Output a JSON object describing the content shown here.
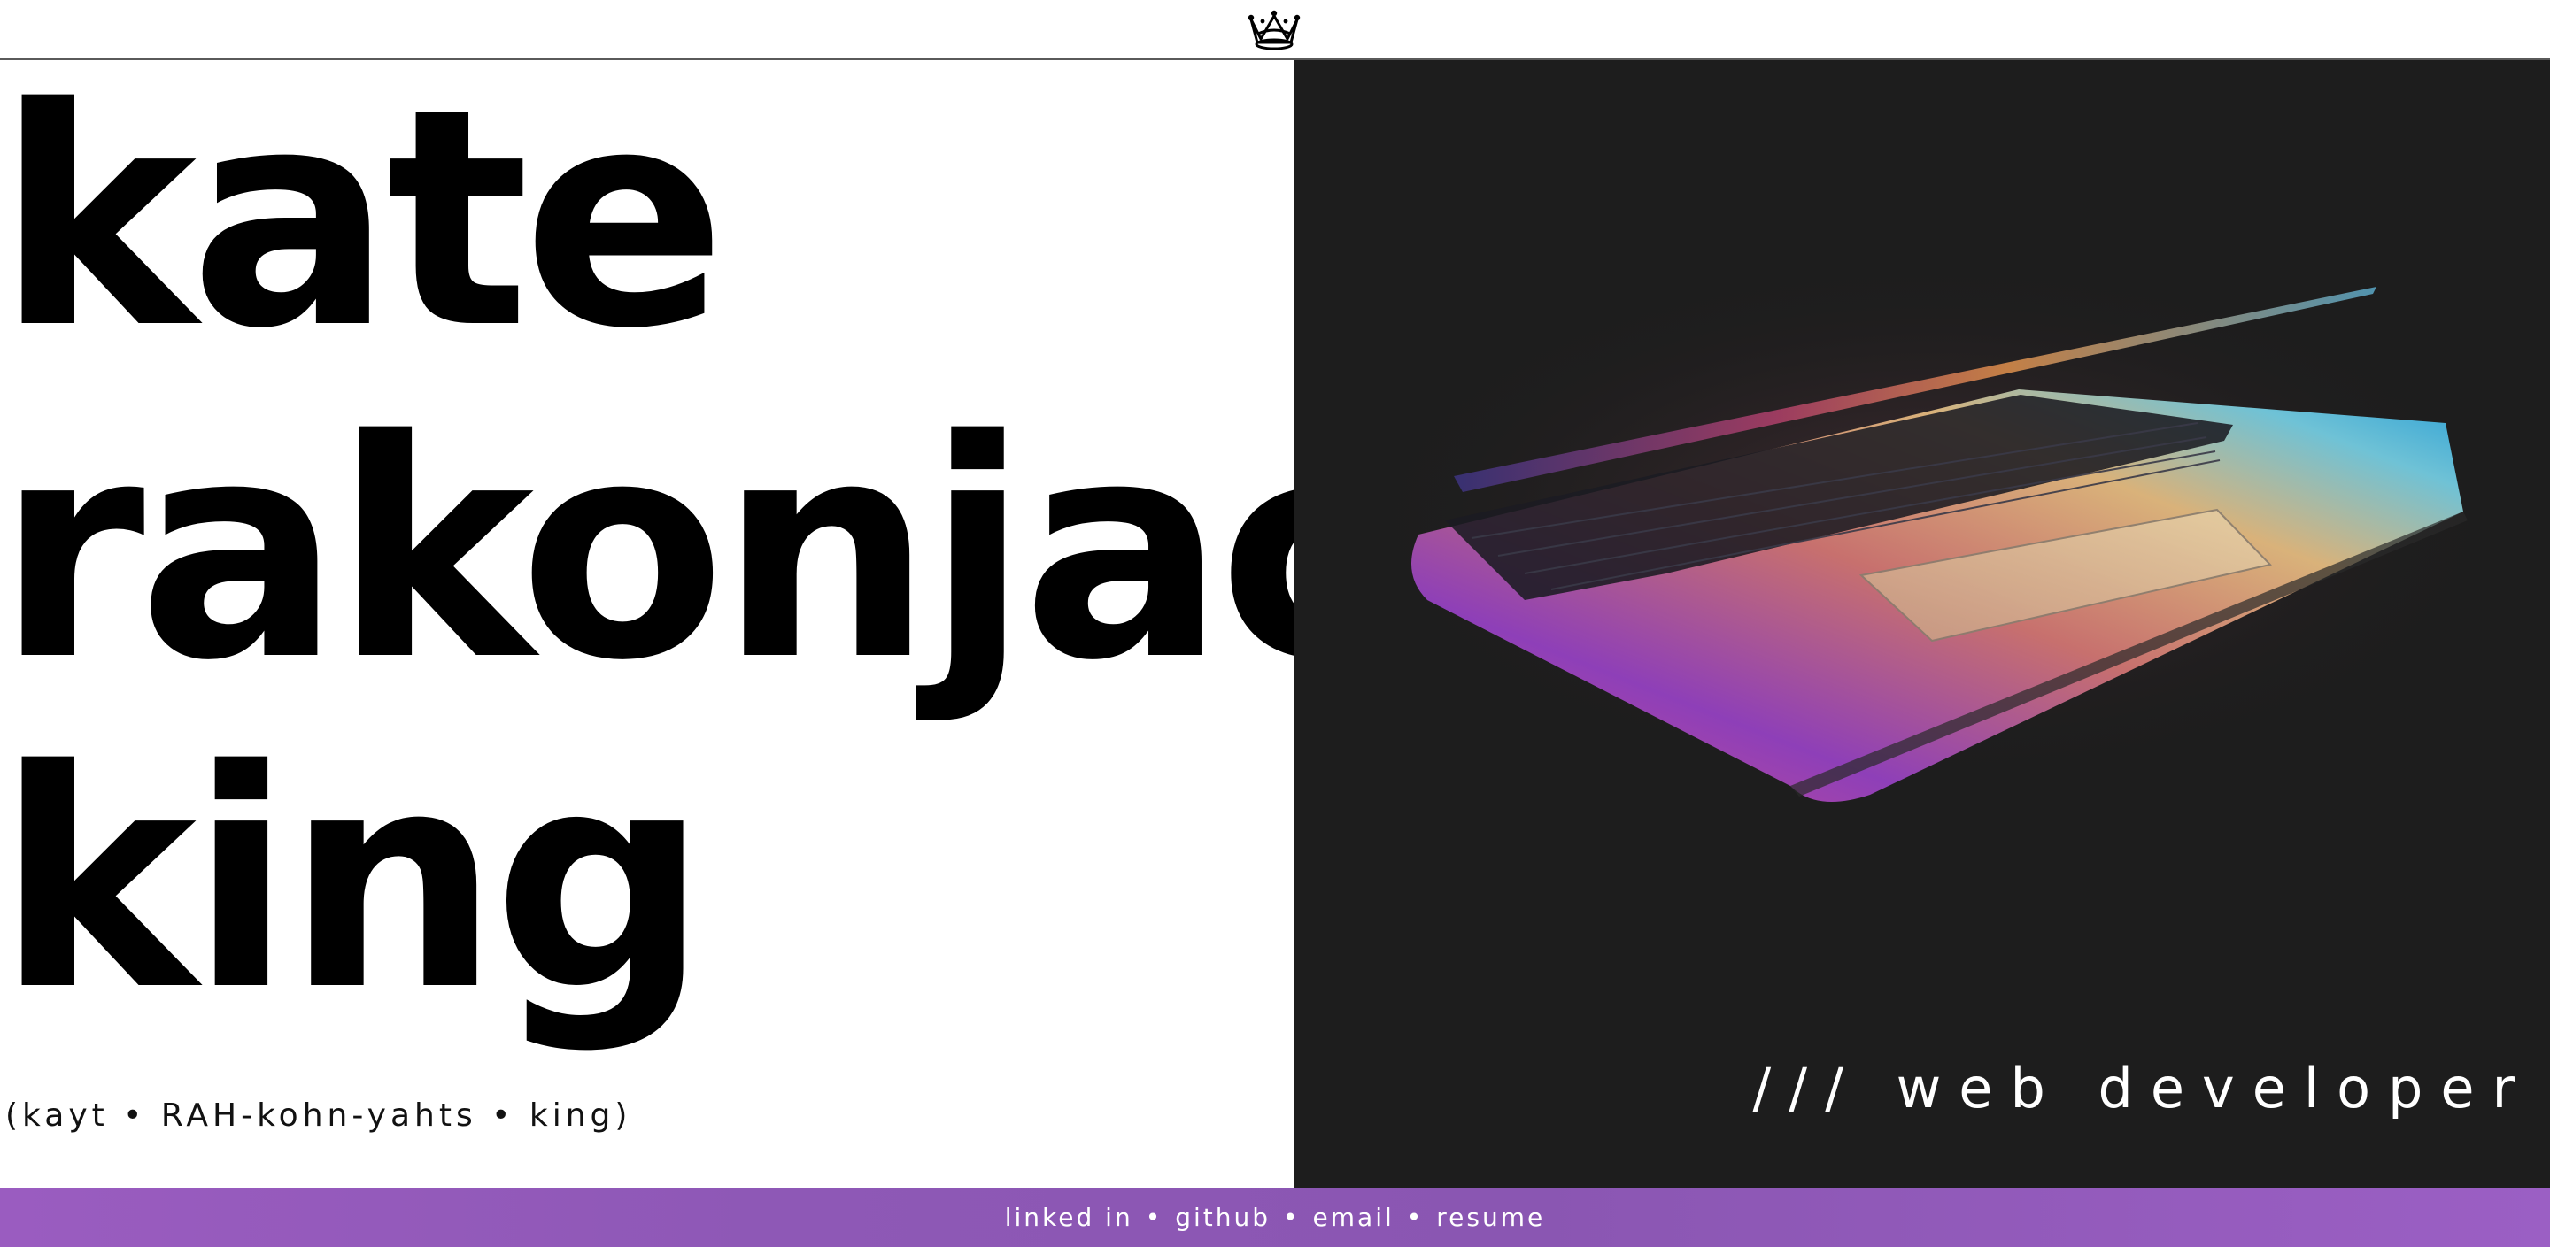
{
  "header": {
    "logo_icon": "crown-icon"
  },
  "hero": {
    "name_lines": [
      "kate",
      "rakonjac",
      "king"
    ],
    "pronunciation": "(kayt • RAH-kohn-yahts • king)",
    "role": "/// web developer",
    "image": "laptop-image"
  },
  "footer": {
    "links": [
      "linked in",
      "github",
      "email",
      "resume"
    ],
    "separator": "•"
  },
  "colors": {
    "background": "#ffffff",
    "text": "#000000",
    "image_panel": "#1d1d1d",
    "footer_accent": "#9b5fc4"
  }
}
